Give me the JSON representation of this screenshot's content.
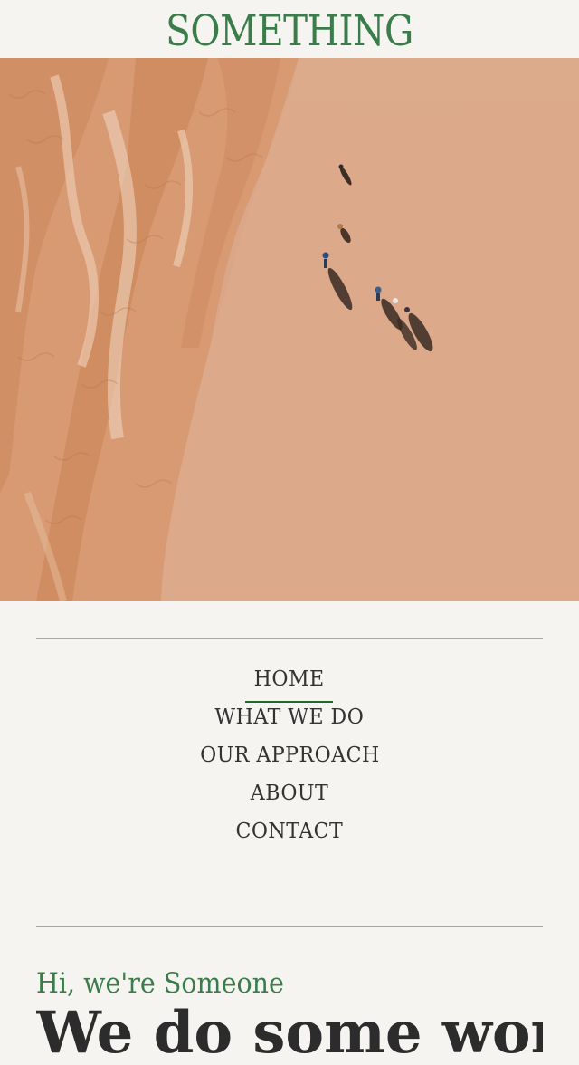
{
  "site": {
    "title": "SOMETHING",
    "title_color": "#3a7d4a"
  },
  "hero": {
    "description_icon": "aerial-beach-photo"
  },
  "nav": {
    "items": [
      {
        "label": "HOME",
        "active": true
      },
      {
        "label": "WHAT WE DO",
        "active": false
      },
      {
        "label": "OUR APPROACH",
        "active": false
      },
      {
        "label": "ABOUT",
        "active": false
      },
      {
        "label": "CONTACT",
        "active": false
      }
    ],
    "active_underline_color": "#1d6a2a"
  },
  "intro": {
    "greeting": "Hi, we're Someone",
    "headline": "We do some work in"
  },
  "colors": {
    "background": "#f5f4f1",
    "accent": "#3a7d4a",
    "text": "#333333",
    "rule": "#a7a7a5"
  }
}
